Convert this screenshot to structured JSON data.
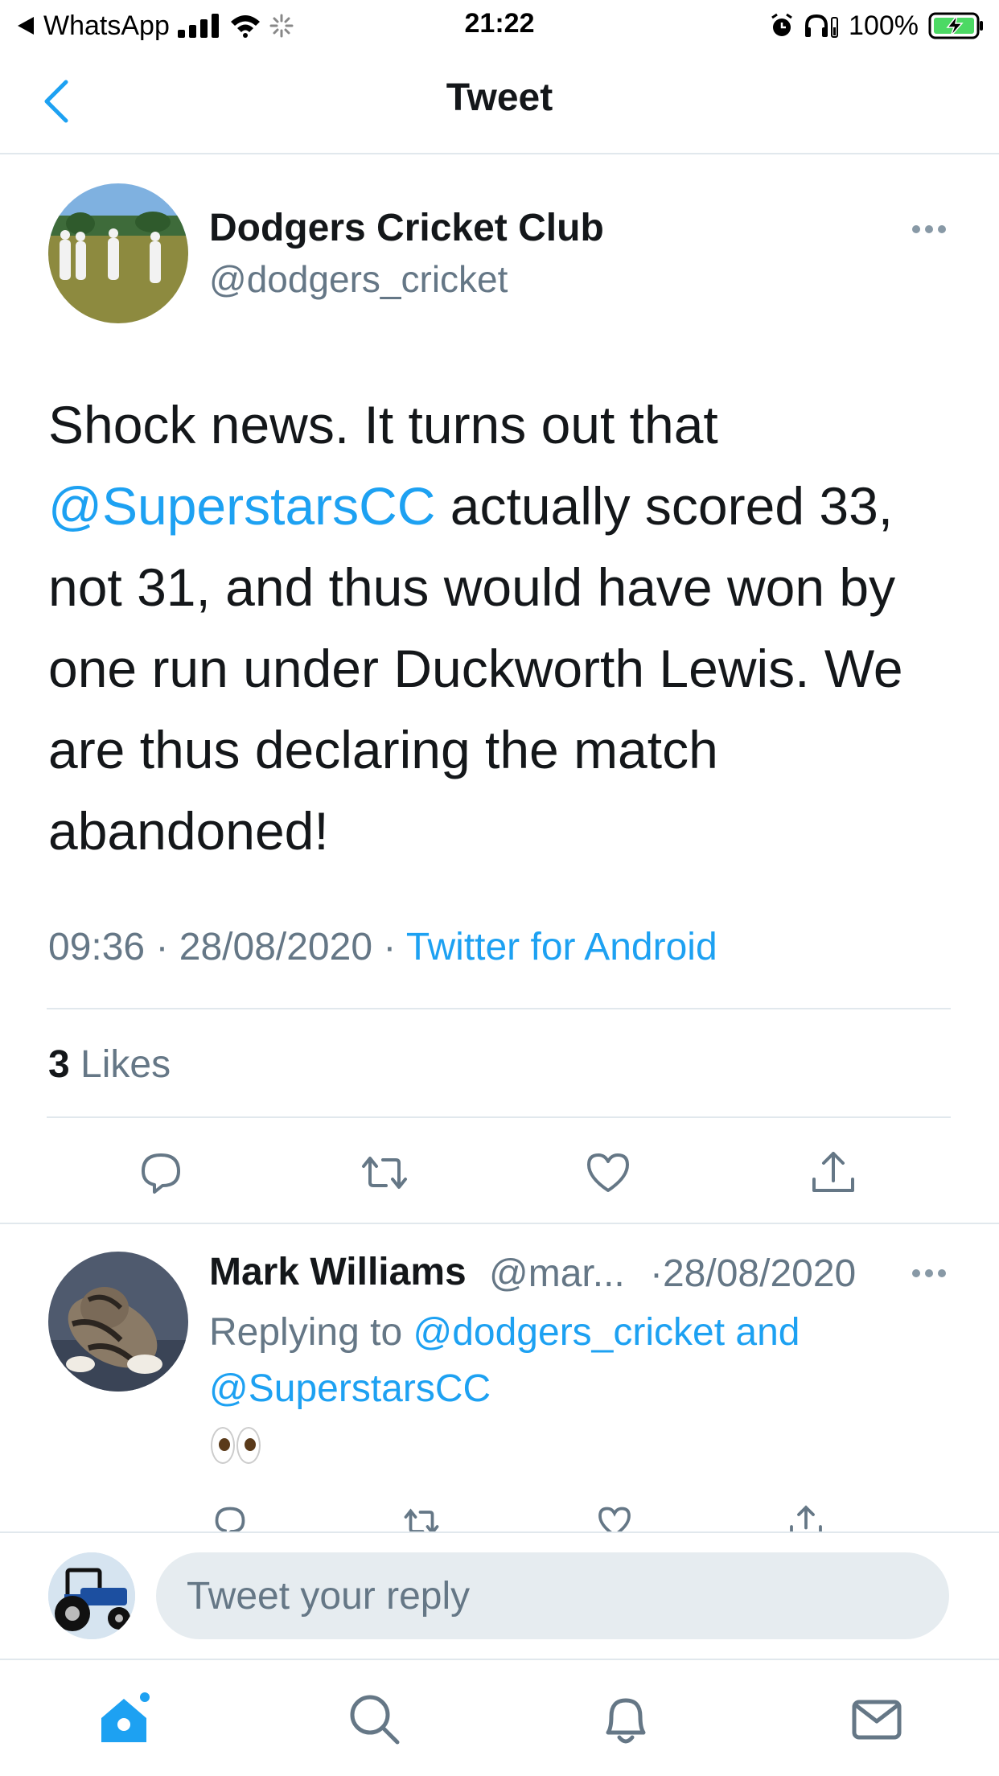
{
  "status_bar": {
    "back_app": "WhatsApp",
    "time": "21:22",
    "battery": "100%"
  },
  "header": {
    "title": "Tweet"
  },
  "tweet": {
    "author_name": "Dodgers Cricket Club",
    "author_handle": "@dodgers_cricket",
    "text_line1": "Shock news. It turns out that",
    "text_mention": "@SuperstarsCC",
    "text_after_mention": " actually scored 33,",
    "text_line3": "not 31, and thus would have won by",
    "text_line4": "one run under Duckworth Lewis. We",
    "text_line5": "are thus declaring the match",
    "text_line6": "abandoned!",
    "time": "09:36",
    "date": "28/08/2020",
    "separator": " · ",
    "source": "Twitter for Android",
    "likes_count": "3",
    "likes_label": " Likes"
  },
  "reply": {
    "author_name": "Mark Williams",
    "author_handle": "@mar...",
    "date": "·28/08/2020",
    "replying_prefix": "Replying to ",
    "replying_to_1": "@dodgers_cricket and",
    "replying_to_2": "@SuperstarsCC"
  },
  "composer": {
    "placeholder": "Tweet your reply"
  },
  "icons": {
    "action_color": "#657786",
    "accent": "#1da1f2"
  }
}
